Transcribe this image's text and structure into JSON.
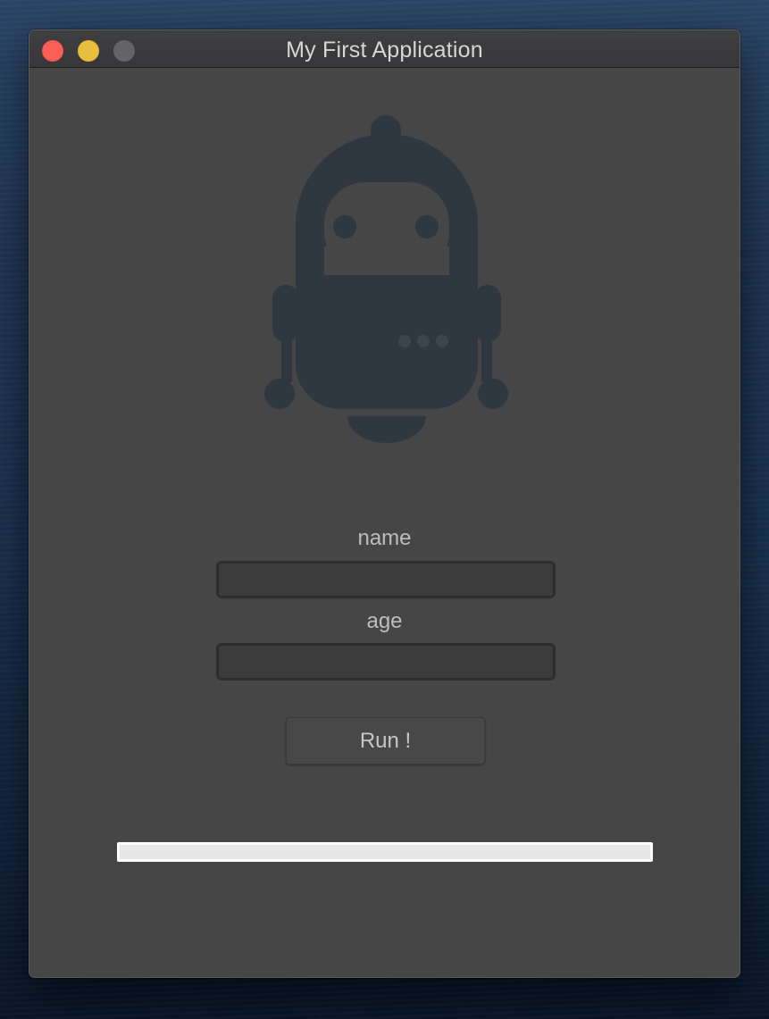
{
  "window": {
    "title": "My First Application"
  },
  "form": {
    "name_label": "name",
    "name_value": "",
    "age_label": "age",
    "age_value": "",
    "run_label": "Run !"
  },
  "progress": {
    "value": 0
  },
  "icons": {
    "logo": "robot-icon",
    "close": "close-window-button",
    "minimize": "minimize-window-button",
    "zoom": "zoom-window-button"
  },
  "colors": {
    "window_bg": "#464646",
    "titlebar_bg": "#3a3a3c",
    "close": "#fc5f57",
    "minimize": "#e7be3d",
    "zoom_disabled": "#646466",
    "robot": "#2f3741",
    "label_text": "#bdbdbd"
  }
}
